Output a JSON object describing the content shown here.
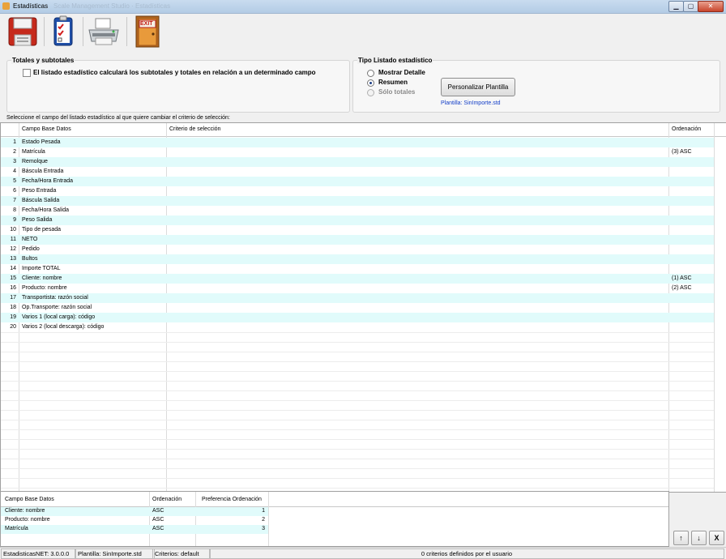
{
  "window": {
    "title": "Estadísticas",
    "faded_caption": "Scale Management Studio · Estadísticas",
    "controls": {
      "minimize": "▁",
      "maximize": "▢",
      "close": "✕"
    }
  },
  "toolbar": {
    "buttons": [
      {
        "icon": "save-disk-icon"
      },
      {
        "icon": "checklist-icon"
      },
      {
        "icon": "printer-icon"
      },
      {
        "icon": "exit-door-icon",
        "label": "EXIT"
      }
    ]
  },
  "totals_group": {
    "title": "Totales y subtotales",
    "checkbox_label": "El listado estadístico calculará los subtotales y totales en relación a un determinado campo",
    "checked": false
  },
  "list_type_group": {
    "title": "Tipo Listado estadístico",
    "options": [
      {
        "label": "Mostrar Detalle",
        "selected": false,
        "enabled": true
      },
      {
        "label": "Resumen",
        "selected": true,
        "enabled": true
      },
      {
        "label": "Sólo totales",
        "selected": false,
        "enabled": false
      }
    ],
    "customize_button": "Personalizar Plantilla",
    "template_link": "Plantilla: SinImporte.std"
  },
  "instruction": "Seleccione el campo del listado estadístico al que quiere cambiar el criterio de selección:",
  "main_grid": {
    "columns": [
      "Campo Base Datos",
      "Criterio de selección",
      "Ordenación"
    ],
    "rows": [
      {
        "n": "1",
        "field": "Estado Pesada",
        "criteria": "",
        "order": ""
      },
      {
        "n": "2",
        "field": "Matrícula",
        "criteria": "",
        "order": "(3) ASC"
      },
      {
        "n": "3",
        "field": "Remolque",
        "criteria": "",
        "order": ""
      },
      {
        "n": "4",
        "field": "Báscula Entrada",
        "criteria": "",
        "order": ""
      },
      {
        "n": "5",
        "field": "Fecha/Hora Entrada",
        "criteria": "",
        "order": ""
      },
      {
        "n": "6",
        "field": "Peso Entrada",
        "criteria": "",
        "order": ""
      },
      {
        "n": "7",
        "field": "Báscula Salida",
        "criteria": "",
        "order": ""
      },
      {
        "n": "8",
        "field": "Fecha/Hora Salida",
        "criteria": "",
        "order": ""
      },
      {
        "n": "9",
        "field": "Peso Salida",
        "criteria": "",
        "order": ""
      },
      {
        "n": "10",
        "field": "Tipo de pesada",
        "criteria": "",
        "order": ""
      },
      {
        "n": "11",
        "field": "NETO",
        "criteria": "",
        "order": ""
      },
      {
        "n": "12",
        "field": "Pedido",
        "criteria": "",
        "order": ""
      },
      {
        "n": "13",
        "field": "Bultos",
        "criteria": "",
        "order": ""
      },
      {
        "n": "14",
        "field": "Importe TOTAL",
        "criteria": "",
        "order": ""
      },
      {
        "n": "15",
        "field": "Cliente: nombre",
        "criteria": "",
        "order": "(1) ASC"
      },
      {
        "n": "16",
        "field": "Producto: nombre",
        "criteria": "",
        "order": "(2) ASC"
      },
      {
        "n": "17",
        "field": "Transportista: razón social",
        "criteria": "",
        "order": ""
      },
      {
        "n": "18",
        "field": "Op.Transporte: razón social",
        "criteria": "",
        "order": ""
      },
      {
        "n": "19",
        "field": "Varios 1 (local carga): código",
        "criteria": "",
        "order": ""
      },
      {
        "n": "20",
        "field": "Varios 2 (local descarga): código",
        "criteria": "",
        "order": ""
      }
    ]
  },
  "sort_grid": {
    "columns": [
      "Campo Base Datos",
      "Ordenación",
      "Preferencia Ordenación"
    ],
    "rows": [
      {
        "field": "Cliente: nombre",
        "order": "ASC",
        "pref": "1"
      },
      {
        "field": "Producto: nombre",
        "order": "ASC",
        "pref": "2"
      },
      {
        "field": "Matrícula",
        "order": "ASC",
        "pref": "3"
      }
    ]
  },
  "side_buttons": {
    "up": "↑",
    "down": "↓",
    "remove": "X"
  },
  "statusbar": {
    "version": "EstadisticasNET: 3.0.0.0",
    "template": "Plantilla: SinImporte.std",
    "criteria": "Criterios: default",
    "message": "0 criterios definidos por el usuario"
  }
}
